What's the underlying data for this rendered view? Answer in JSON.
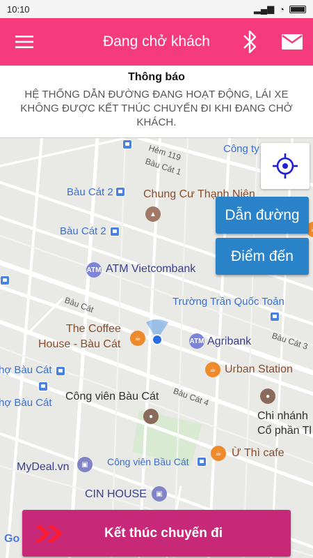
{
  "statusbar": {
    "time": "10:10"
  },
  "appbar": {
    "title": "Đang chở khách",
    "menu_icon": "hamburger-menu-icon",
    "bluetooth_icon": "bluetooth-icon",
    "mail_icon": "mail-icon"
  },
  "notice": {
    "title": "Thông báo",
    "body": "HỆ THỐNG DẪN ĐƯỜNG ĐANG HOẠT ĐỘNG, LÁI XE KHÔNG ĐƯỢC KẾT THÚC CHUYẾN ĐI KHI ĐANG CHỞ KHÁCH."
  },
  "map": {
    "labels": {
      "hem119": "Hẻm 119",
      "baucat1": "Bàu Cát 1",
      "congty": "Công ty",
      "baucat2a": "Bàu Cát 2",
      "chungcu": "Chung Cư Thạnh Niên",
      "baucat2b": "Bàu Cát 2",
      "atm_vcb": "ATM Vietcombank",
      "baucat_road": "Bàu Cát",
      "truong": "Trường Trần Quốc Toản",
      "coffee1": "The Coffee",
      "coffee2": "House - Bàu Cát",
      "agribank": "Agribank",
      "baucat3": "Bàu Cát 3",
      "hobaucat1": "hợ Bàu Cát",
      "urban": "Urban Station",
      "hobaucat2": "hợ Bàu Cát",
      "congvien1": "Công viên Bàu Cát",
      "baucat4": "Bàu Cát 4",
      "chinhanh1": "Chi nhánh",
      "chinhanh2": "Cổ phần Tl",
      "uthi": "Ừ Thì cafe",
      "mydeal": "MyDeal.vn",
      "congvien2": "Công viên Bầu Cát",
      "cinhouse": "CIN HOUSE",
      "google": "Go"
    },
    "directions_button": "Dẫn đường",
    "destination_button": "Điểm đến"
  },
  "end_trip_button": "Kết thúc chuyến đi",
  "colors": {
    "appbar": "#f53b7c",
    "map_button": "#2a83c9",
    "end_trip": "#c72878"
  }
}
